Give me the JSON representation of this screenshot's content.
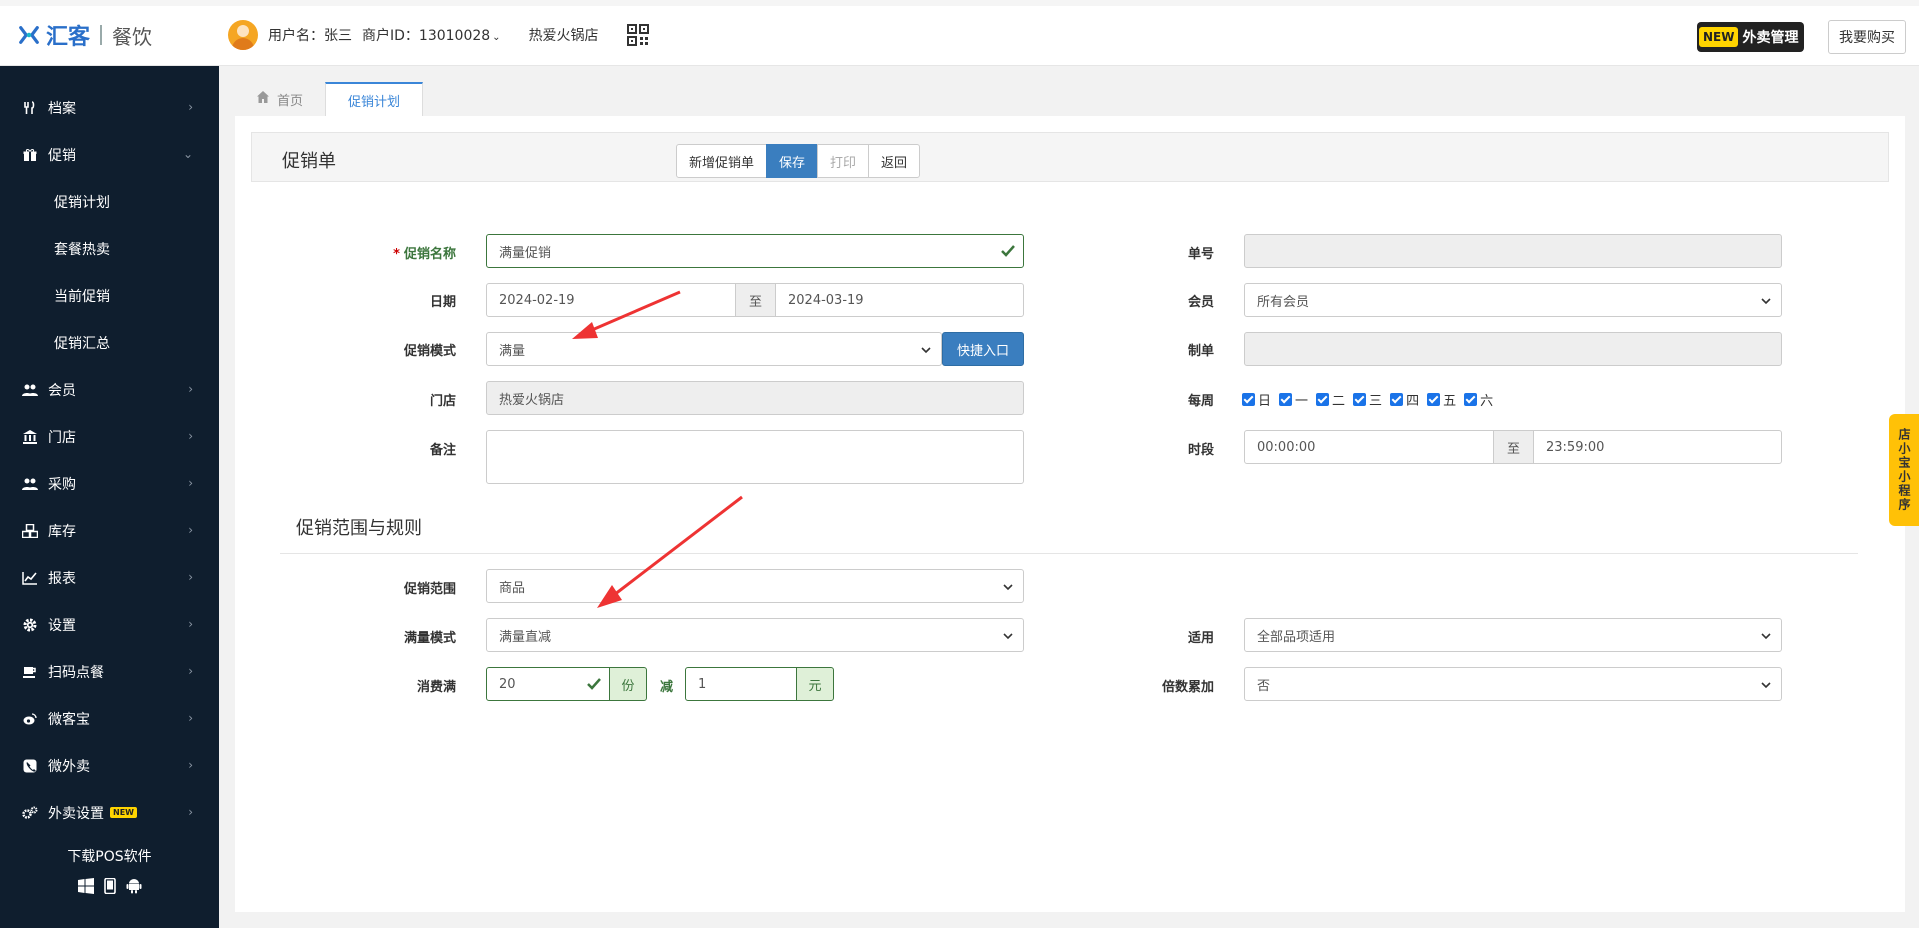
{
  "header": {
    "brand": "汇客",
    "product": "餐饮",
    "username": "用户名：张三",
    "merchant_id": "商户ID：13010028",
    "store": "热爱火锅店",
    "new_label": "NEW",
    "takeout_mgmt": "外卖管理",
    "buy_label": "我要购买"
  },
  "sidebar": {
    "items": [
      {
        "label": "档案",
        "icon": "utensils-icon"
      },
      {
        "label": "促销",
        "icon": "gift-icon"
      },
      {
        "label": "促销计划"
      },
      {
        "label": "套餐热卖"
      },
      {
        "label": "当前促销"
      },
      {
        "label": "促销汇总"
      },
      {
        "label": "会员",
        "icon": "users-icon"
      },
      {
        "label": "门店",
        "icon": "bank-icon"
      },
      {
        "label": "采购",
        "icon": "users-icon"
      },
      {
        "label": "库存",
        "icon": "cubes-icon"
      },
      {
        "label": "报表",
        "icon": "chart-line-icon"
      },
      {
        "label": "设置",
        "icon": "gear-icon"
      },
      {
        "label": "扫码点餐",
        "icon": "coffee-icon"
      },
      {
        "label": "微客宝",
        "icon": "weibo-icon"
      },
      {
        "label": "微外卖",
        "icon": "phone-icon"
      },
      {
        "label": "外卖设置",
        "icon": "gears-icon",
        "tag": "NEW"
      }
    ],
    "download": "下载POS软件"
  },
  "tabs": {
    "home": "首页",
    "active": "促销计划"
  },
  "panel": {
    "title": "促销单",
    "buttons": {
      "new": "新增促销单",
      "save": "保存",
      "print": "打印",
      "back": "返回"
    }
  },
  "form": {
    "name_label": "促销名称",
    "name_value": "满量促销",
    "date_label": "日期",
    "date_start": "2024-02-19",
    "date_to": "至",
    "date_end": "2024-03-19",
    "mode_label": "促销模式",
    "mode_value": "满量",
    "quick_entry": "快捷入口",
    "store_label": "门店",
    "store_value": "热爱火锅店",
    "remark_label": "备注",
    "order_no_label": "单号",
    "member_label": "会员",
    "member_value": "所有会员",
    "creator_label": "制单",
    "weekly_label": "每周",
    "weekdays": [
      "日",
      "一",
      "二",
      "三",
      "四",
      "五",
      "六"
    ],
    "period_label": "时段",
    "period_start": "00:00:00",
    "period_to": "至",
    "period_end": "23:59:00"
  },
  "rules": {
    "section_title": "促销范围与规则",
    "scope_label": "促销范围",
    "scope_value": "商品",
    "full_mode_label": "满量模式",
    "full_mode_value": "满量直减",
    "spend_label": "消费满",
    "spend_value": "20",
    "spend_unit": "份",
    "reduce_label": "减",
    "reduce_value": "1",
    "reduce_unit": "元",
    "apply_label": "适用",
    "apply_value": "全部品项适用",
    "multiple_label": "倍数累加",
    "multiple_value": "否"
  },
  "float_tab": "店小宝小程序",
  "colors": {
    "sidebar_bg": "#0f1e2e",
    "primary": "#3a7ebf",
    "success": "#3c763d",
    "accent_yellow": "#ffc107",
    "annotation_arrow": "#ee3333"
  }
}
